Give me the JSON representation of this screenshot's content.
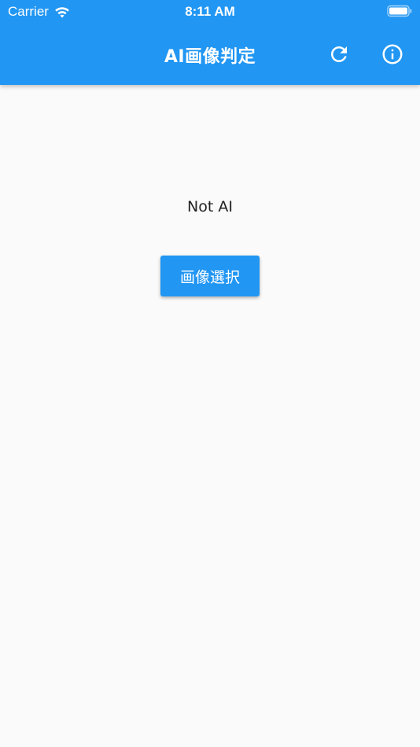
{
  "status_bar": {
    "carrier": "Carrier",
    "time": "8:11 AM",
    "wifi_icon": "wifi-icon",
    "battery_icon": "battery-icon"
  },
  "app_bar": {
    "title": "AI画像判定",
    "actions": [
      {
        "icon": "refresh-icon"
      },
      {
        "icon": "info-icon"
      }
    ]
  },
  "main": {
    "result_text": "Not AI",
    "select_button_label": "画像選択"
  },
  "colors": {
    "primary": "#2196f3",
    "background": "#fafafa",
    "text": "#222222"
  }
}
